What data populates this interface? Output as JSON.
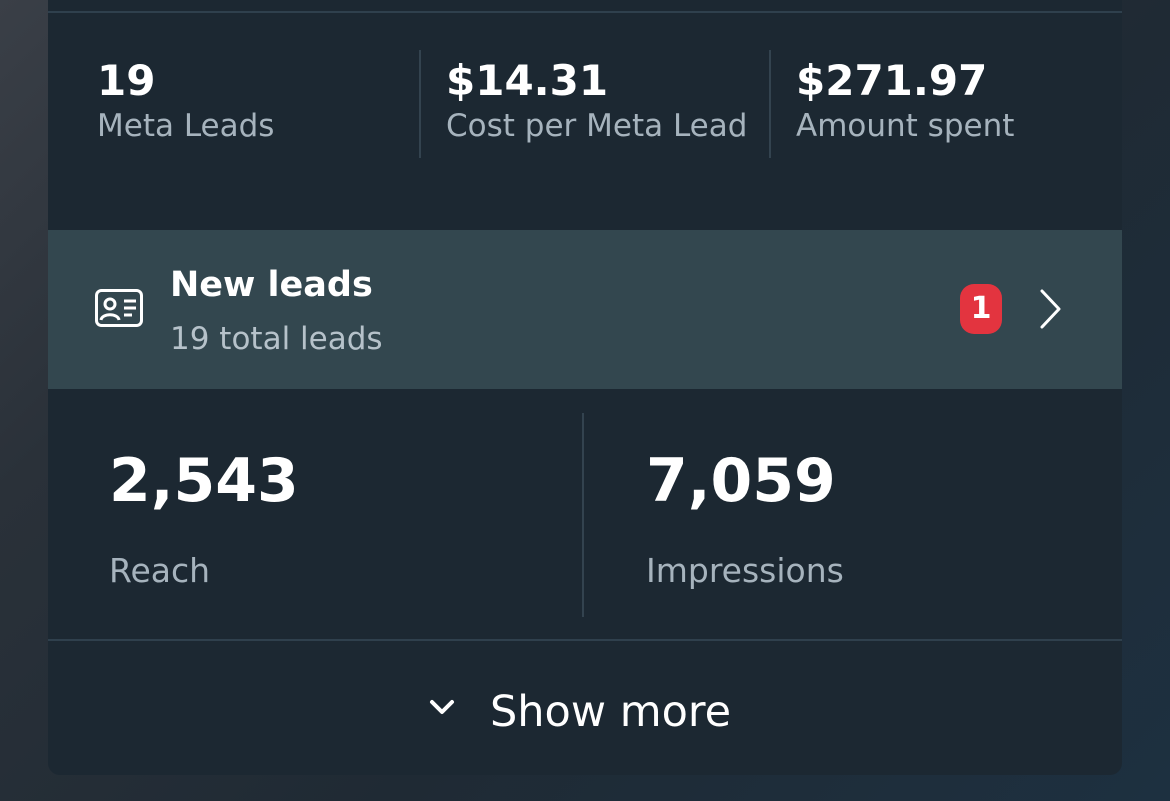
{
  "summary": {
    "stats": [
      {
        "value": "19",
        "label": "Meta Leads"
      },
      {
        "value": "$14.31",
        "label": "Cost per Meta Lead"
      },
      {
        "value": "$271.97",
        "label": "Amount spent"
      }
    ]
  },
  "leads": {
    "title": "New leads",
    "subtitle": "19 total leads",
    "badge": "1",
    "icon": "contact-card-icon"
  },
  "metrics": [
    {
      "value": "2,543",
      "label": "Reach"
    },
    {
      "value": "7,059",
      "label": "Impressions"
    }
  ],
  "footer": {
    "show_more_label": "Show more",
    "icon": "chevron-down-icon"
  },
  "colors": {
    "card_bg": "#1c2832",
    "row_highlight": "#33474f",
    "badge": "#e3343f",
    "muted_text": "#a6b3bd"
  }
}
